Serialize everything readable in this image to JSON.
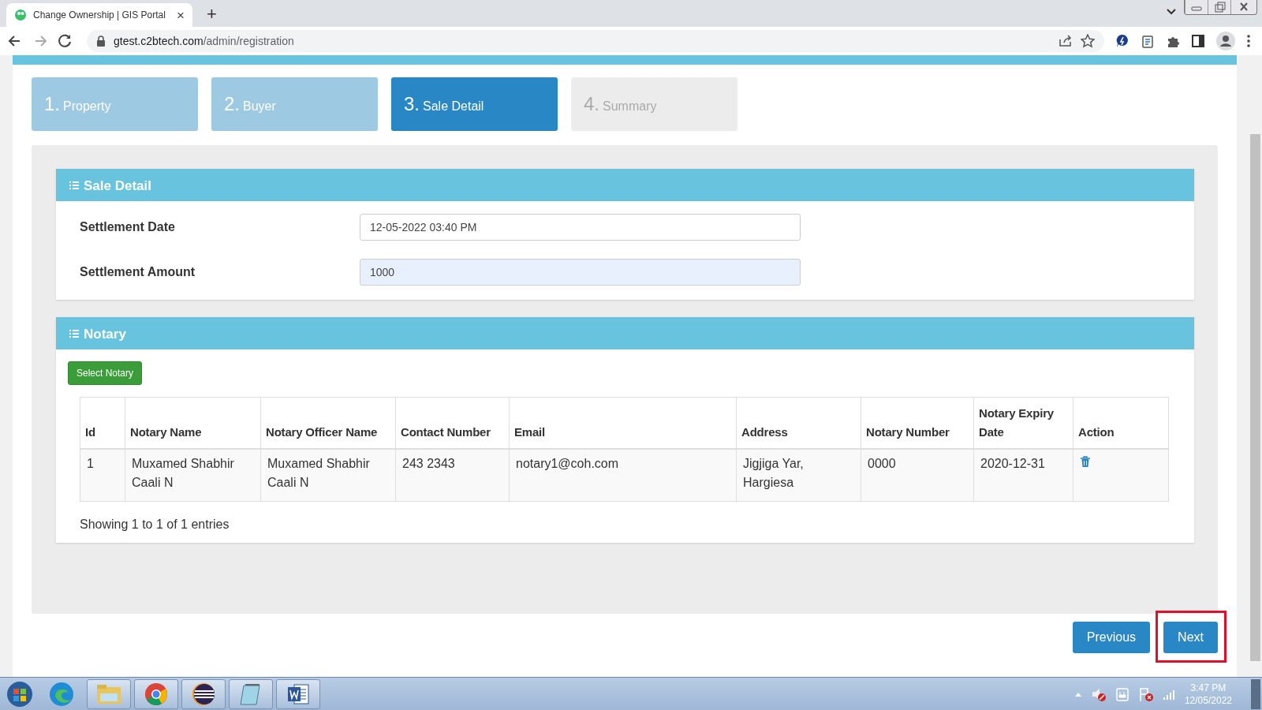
{
  "browser": {
    "tab_title": "Change Ownership | GIS Portal",
    "tab_close": "×",
    "new_tab": "+",
    "url_host": "gtest.c2btech.com",
    "url_path": "/admin/registration"
  },
  "steps": [
    {
      "number": "1.",
      "label": "Property",
      "selected": false
    },
    {
      "number": "2.",
      "label": "Buyer",
      "selected": false
    },
    {
      "number": "3.",
      "label": "Sale Detail",
      "selected": true
    },
    {
      "number": "4.",
      "label": "Summary",
      "selected": false
    }
  ],
  "sale_detail": {
    "title": "Sale Detail",
    "fields": [
      {
        "label": "Settlement Date",
        "value": "12-05-2022 03:40 PM",
        "focused": false
      },
      {
        "label": "Settlement Amount",
        "value": "1000",
        "focused": true
      }
    ]
  },
  "notary": {
    "title": "Notary",
    "select_button": "Select Notary",
    "table": {
      "columns": [
        "Id",
        "Notary Name",
        "Notary Officer Name",
        "Contact Number",
        "Email",
        "Address",
        "Notary Number",
        "Notary Expiry Date",
        "Action"
      ],
      "rows": [
        {
          "cells": [
            "1",
            "Muxamed Shabhir Caali N",
            "Muxamed Shabhir Caali N",
            "243 2343",
            "notary1@coh.com",
            "Jigjiga Yar, Hargiesa",
            "0000",
            "2020-12-31"
          ]
        }
      ]
    },
    "info": "Showing 1 to 1 of 1 entries"
  },
  "buttons": [
    {
      "label": "Previous",
      "highlighted": false
    },
    {
      "label": "Next",
      "highlighted": true
    }
  ],
  "taskbar": {
    "time": "3:47 PM",
    "date": "12/05/2022"
  }
}
